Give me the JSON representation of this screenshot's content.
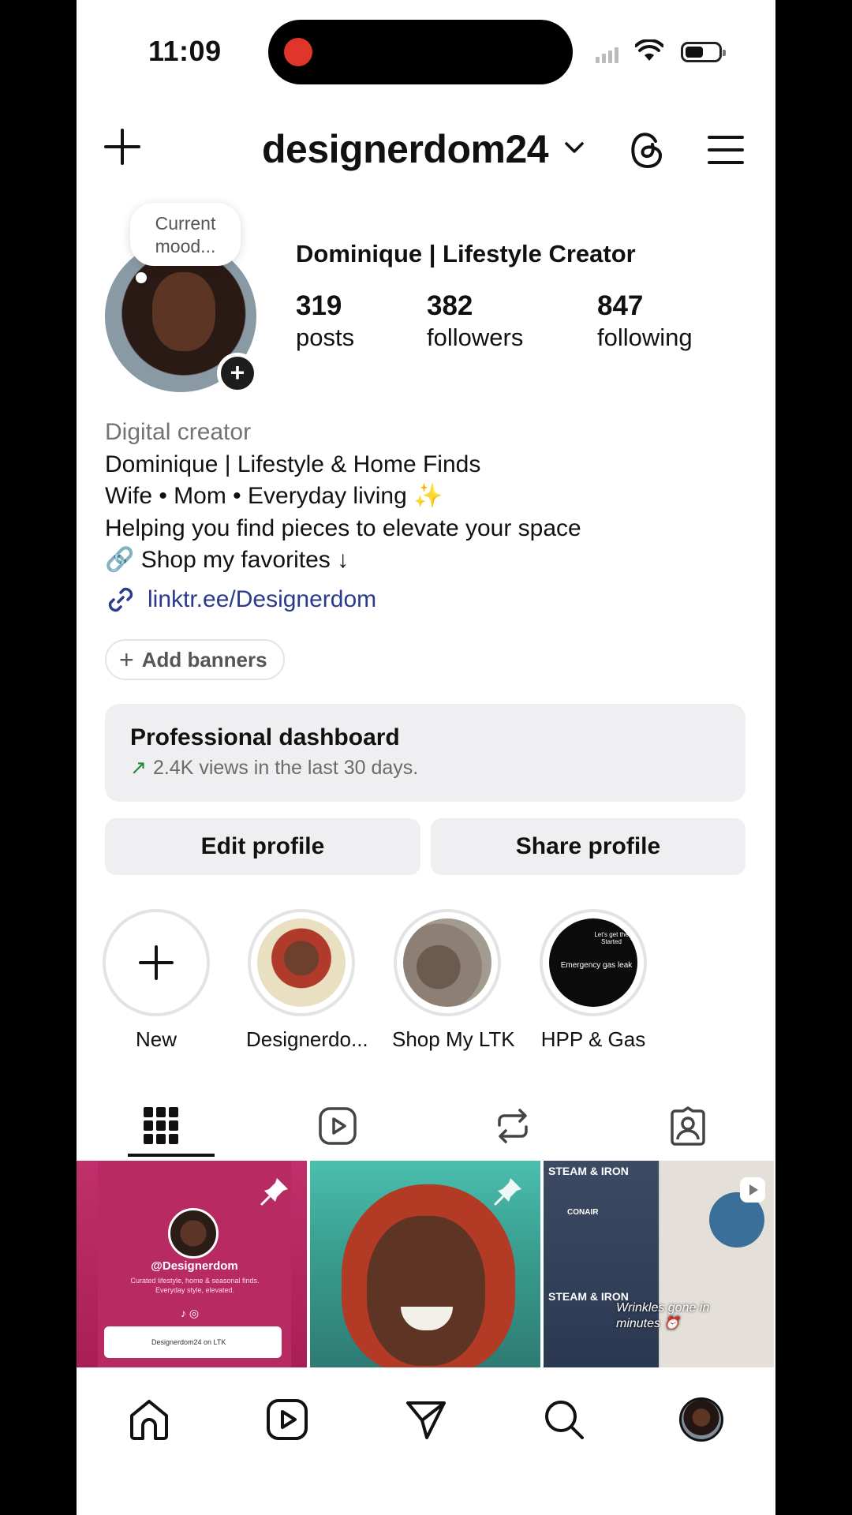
{
  "status_bar": {
    "time": "11:09"
  },
  "header": {
    "username": "designerdom24"
  },
  "profile": {
    "mood_note": "Current mood...",
    "display_name": "Dominique | Lifestyle Creator",
    "stats": [
      {
        "value": "319",
        "label": "posts"
      },
      {
        "value": "382",
        "label": "followers"
      },
      {
        "value": "847",
        "label": "following"
      }
    ],
    "category": "Digital creator",
    "bio_lines": [
      "Dominique | Lifestyle & Home Finds",
      "Wife • Mom • Everyday living ✨",
      "Helping you find pieces to elevate your space",
      "🔗 Shop my favorites ↓"
    ],
    "link": "linktr.ee/Designerdom",
    "add_banners": "Add banners"
  },
  "dashboard": {
    "title": "Professional dashboard",
    "subtitle": "2.4K views in the last 30 days."
  },
  "buttons": {
    "edit": "Edit profile",
    "share": "Share profile"
  },
  "highlights": [
    {
      "label": "New"
    },
    {
      "label": "Designerdo..."
    },
    {
      "label": "Shop My LTK"
    },
    {
      "label": "HPP & Gas"
    }
  ],
  "grid": {
    "post1_handle": "@Designerdom",
    "post1_desc": "Curated lifestyle, home & seasonal finds. Everyday style, elevated.",
    "post1_card": "Designerdom24 on LTK",
    "post3_brand": "CONAIR",
    "post3_label1": "STEAM & IRON",
    "post3_caption": "Wrinkles gone in minutes ⏰",
    "highlight4_text": "Emergency gas leak",
    "highlight4_top": "Let's get the Started"
  },
  "icons": {
    "create": "plus-icon",
    "dropdown": "chevron-down-icon",
    "threads": "threads-icon",
    "menu": "hamburger-menu-icon",
    "link": "link-icon",
    "grid_tab": "grid-icon",
    "reels_tab": "reels-icon",
    "reposts_tab": "repost-icon",
    "tagged_tab": "tagged-icon",
    "home": "home-icon",
    "reels": "reels-icon",
    "messages": "send-icon",
    "search": "search-icon"
  }
}
